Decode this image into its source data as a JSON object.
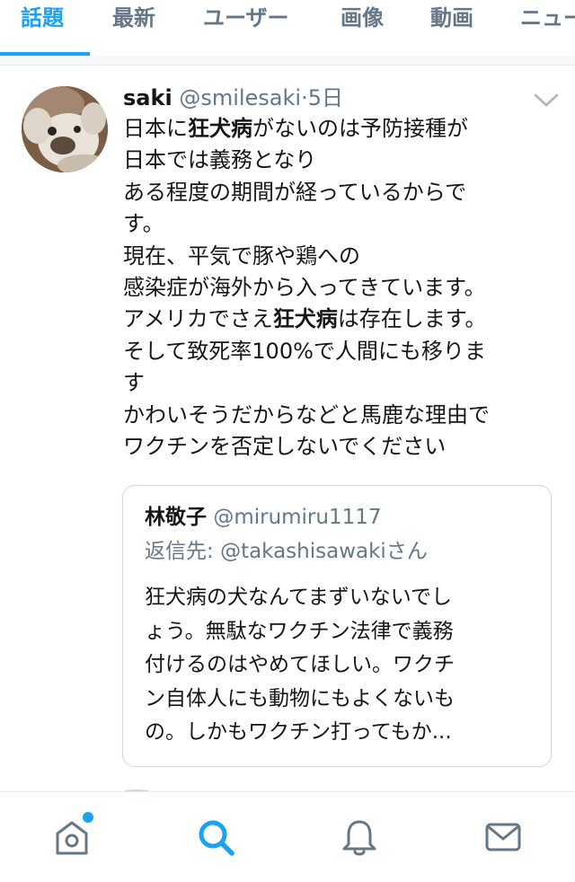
{
  "tabs": [
    {
      "label": "話題"
    },
    {
      "label": "最新"
    },
    {
      "label": "ユーザー"
    },
    {
      "label": "画像"
    },
    {
      "label": "動画"
    },
    {
      "label": "ニュー"
    }
  ],
  "tweet": {
    "name": "saki",
    "handle": "@smilesaki",
    "separator": "·",
    "time": "5日",
    "lines": [
      [
        "日本に",
        "狂犬病",
        "がないのは予防接種が"
      ],
      [
        "日本では義務となり",
        "",
        ""
      ],
      [
        "ある程度の期間が経っているからで",
        "",
        ""
      ],
      [
        "す。",
        "",
        ""
      ],
      [
        "現在、平気で豚や鶏への",
        "",
        ""
      ],
      [
        "感染症が海外から入ってきています。",
        "",
        ""
      ],
      [
        "アメリカでさえ",
        "狂犬病",
        "は存在します。"
      ],
      [
        "そして致死率100%で人間にも移りま",
        "",
        ""
      ],
      [
        "す",
        "",
        ""
      ],
      [
        "かわいそうだからなどと馬鹿な理由で",
        "",
        ""
      ],
      [
        "ワクチンを否定しないでください",
        "",
        ""
      ]
    ],
    "quote": {
      "name": "林敬子",
      "handle": "@mirumiru1117",
      "reply_prefix": "返信先: ",
      "reply_handle": "@takashisawakiさん",
      "lines": [
        "狂犬病の犬なんてまずいないでし",
        "ょう。無駄なワクチン法律で義務",
        "付けるのはやめてほしい。ワクチ",
        "ン自体人にも動物にもよくないも",
        "の。しかもワクチン打ってもか..."
      ]
    }
  },
  "bottom_nav": [
    {
      "icon": "home-icon",
      "has_notification": true
    },
    {
      "icon": "search-icon",
      "active": true
    },
    {
      "icon": "bell-icon"
    },
    {
      "icon": "mail-icon"
    }
  ],
  "colors": {
    "accent": "#1da1f2",
    "text": "#14171a",
    "muted": "#657786",
    "border": "#ccd6dd"
  }
}
